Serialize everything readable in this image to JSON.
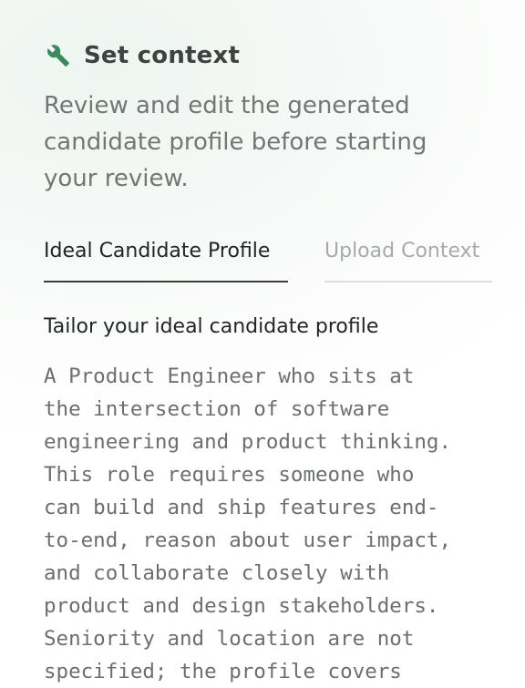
{
  "header": {
    "icon": "wrench-icon",
    "title": "Set context",
    "accent_color": "#3a8a5f"
  },
  "subtitle": "Review and edit the generated candidate profile before starting your review.",
  "tabs": [
    {
      "label": "Ideal Candidate Profile",
      "active": true
    },
    {
      "label": "Upload Context",
      "active": false
    }
  ],
  "profile": {
    "heading": "Tailor your ideal candidate profile",
    "text": "A Product Engineer who sits at\nthe intersection of software\nengineering and product thinking.\nThis role requires someone who\ncan build and ship features end-\nto-end, reason about user impact,\nand collaborate closely with\nproduct and design stakeholders.\nSeniority and location are not\nspecified; the profile covers"
  }
}
